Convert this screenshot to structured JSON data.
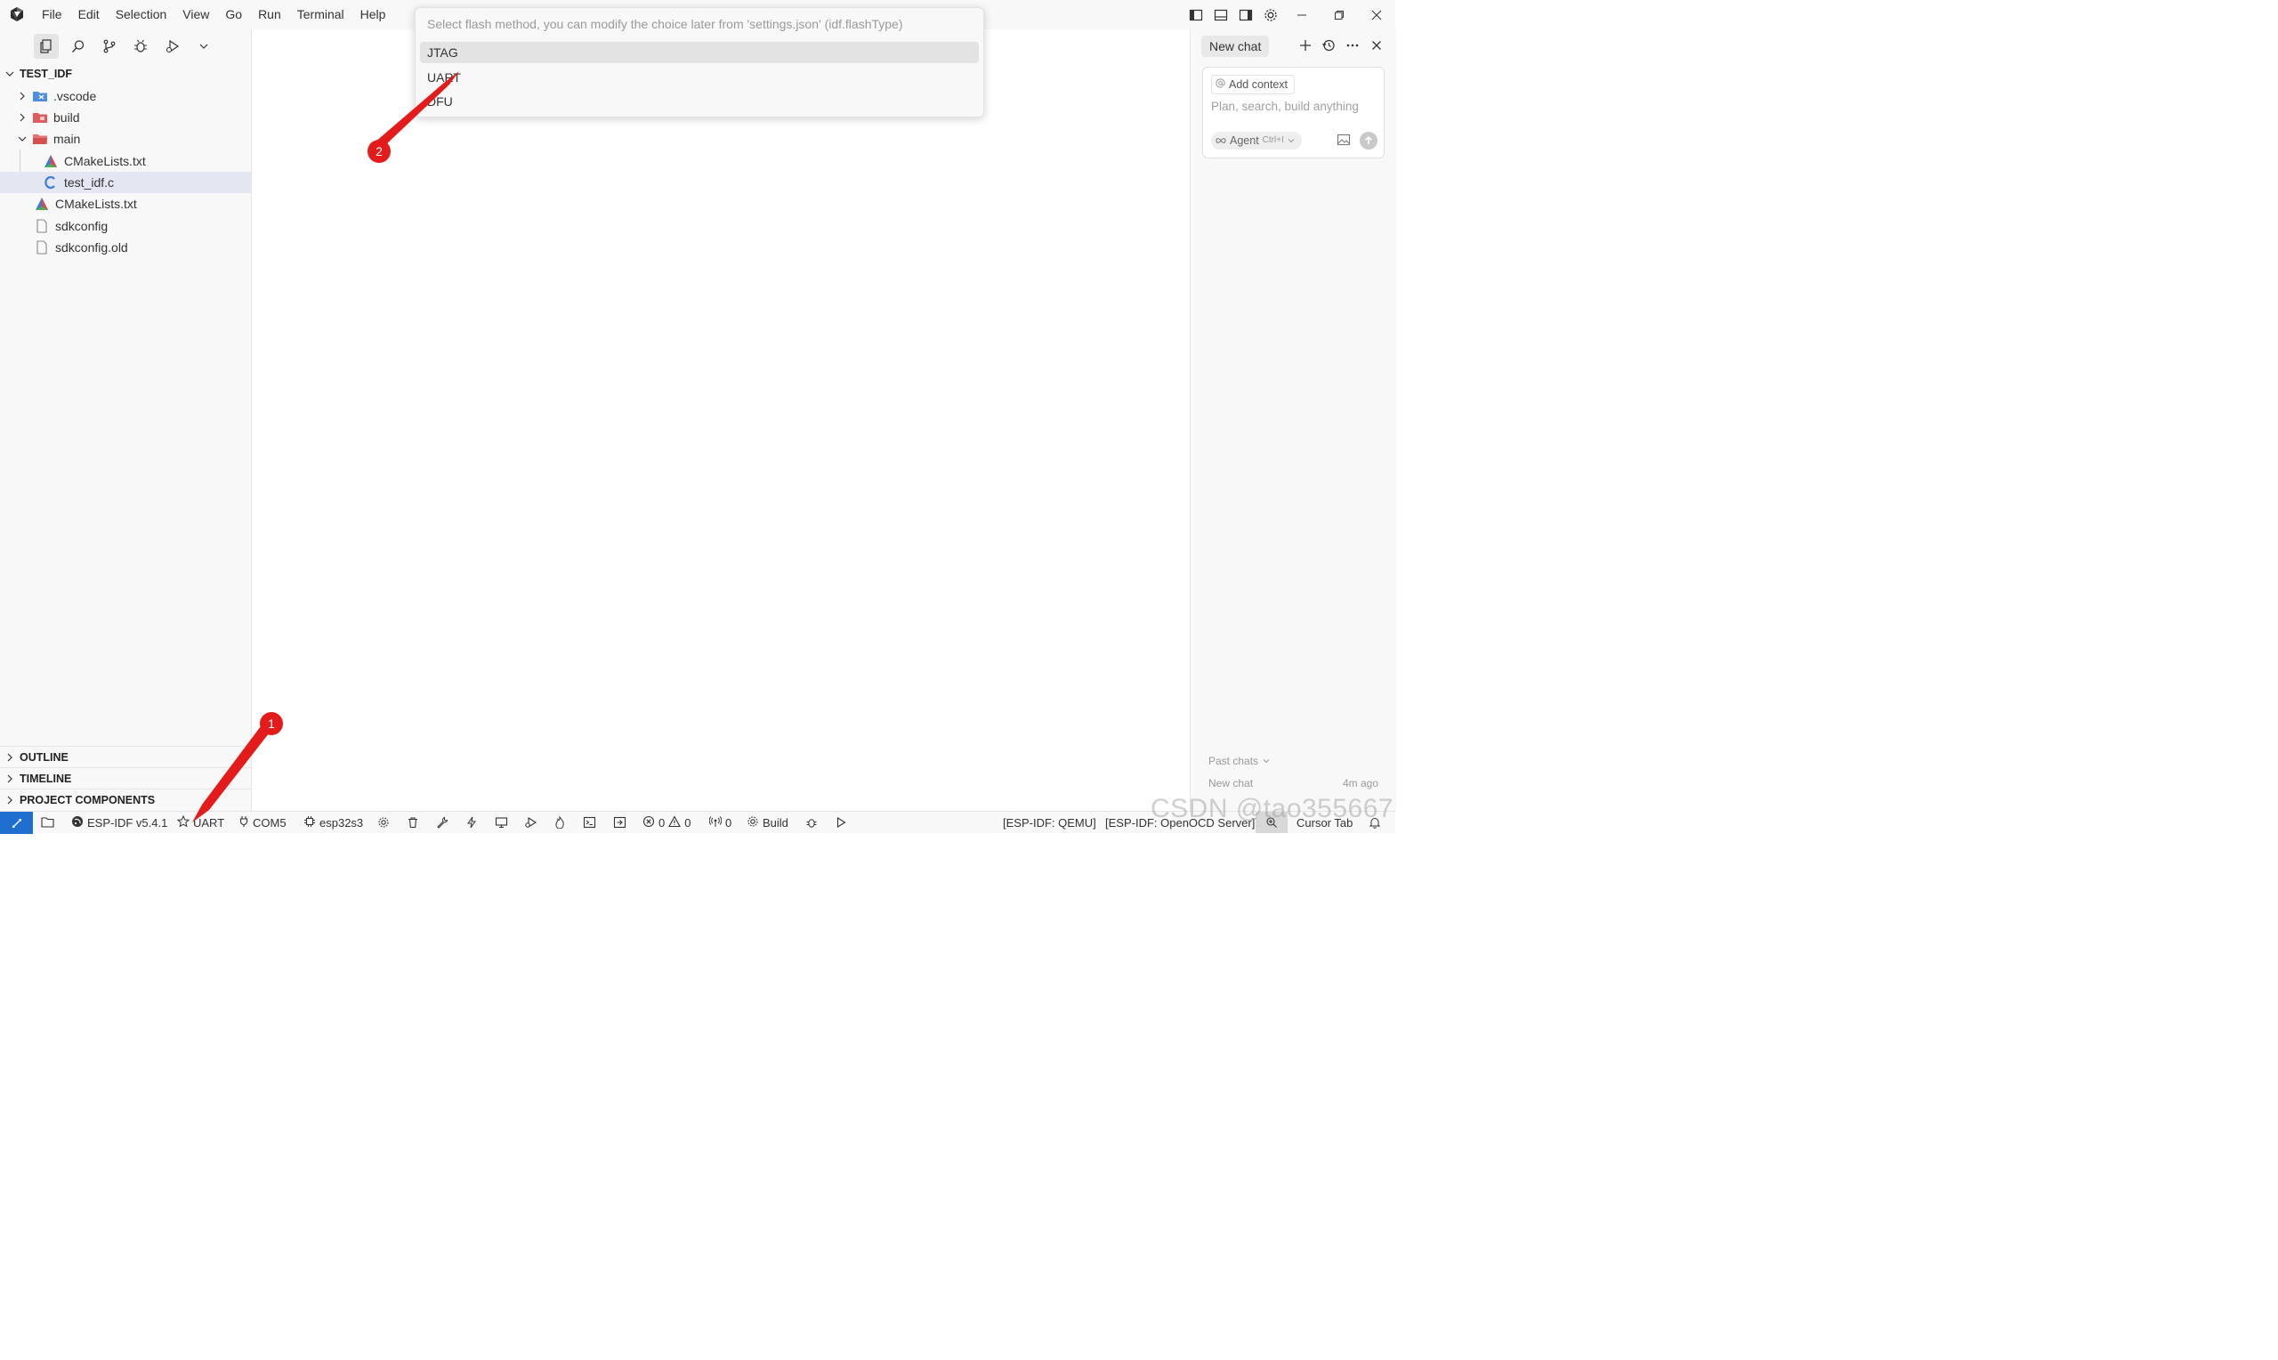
{
  "menu": [
    "File",
    "Edit",
    "Selection",
    "View",
    "Go",
    "Run",
    "Terminal",
    "Help"
  ],
  "explorer": {
    "root": "TEST_IDF",
    "items": [
      {
        "name": ".vscode",
        "type": "folder",
        "expanded": false,
        "icon": "vscode-folder-icon"
      },
      {
        "name": "build",
        "type": "folder",
        "expanded": false,
        "icon": "build-folder-icon"
      },
      {
        "name": "main",
        "type": "folder",
        "expanded": true,
        "icon": "main-folder-icon"
      },
      {
        "name": "CMakeLists.txt",
        "type": "file",
        "icon": "cmake-icon"
      },
      {
        "name": "test_idf.c",
        "type": "file",
        "icon": "c-file-icon",
        "selected": true
      },
      {
        "name": "CMakeLists.txt",
        "type": "file",
        "icon": "cmake-icon"
      },
      {
        "name": "sdkconfig",
        "type": "file",
        "icon": "file-icon"
      },
      {
        "name": "sdkconfig.old",
        "type": "file",
        "icon": "file-icon"
      }
    ],
    "sections": [
      "OUTLINE",
      "TIMELINE",
      "PROJECT COMPONENTS"
    ]
  },
  "quick_pick": {
    "placeholder": "Select flash method, you can modify the choice later from 'settings.json' (idf.flashType)",
    "options": [
      "JTAG",
      "UART",
      "DFU"
    ],
    "active_option": "JTAG"
  },
  "chat": {
    "tab_label": "New chat",
    "add_context": "Add context",
    "input_placeholder": "Plan, search, build anything",
    "agent_label": "Agent",
    "agent_shortcut": "Ctrl+I",
    "past_chats_label": "Past chats",
    "recent_chat_title": "New chat",
    "recent_chat_time": "4m ago"
  },
  "status_bar": {
    "idf_version": "ESP-IDF v5.4.1",
    "flash_type": "UART",
    "port": "COM5",
    "target": "esp32s3",
    "errors": "0",
    "warnings": "0",
    "ports": "0",
    "build_label": "Build",
    "qemu": "[ESP-IDF: QEMU]",
    "openocd": "[ESP-IDF: OpenOCD Server]",
    "cursor_tab": "Cursor Tab"
  },
  "annotations": {
    "badge1": "1",
    "badge2": "2"
  },
  "watermark": "CSDN @tao355667",
  "colors": {
    "accent": "#1f6fd1",
    "annotation": "#e41b1b",
    "selection": "#e4e6f1"
  }
}
